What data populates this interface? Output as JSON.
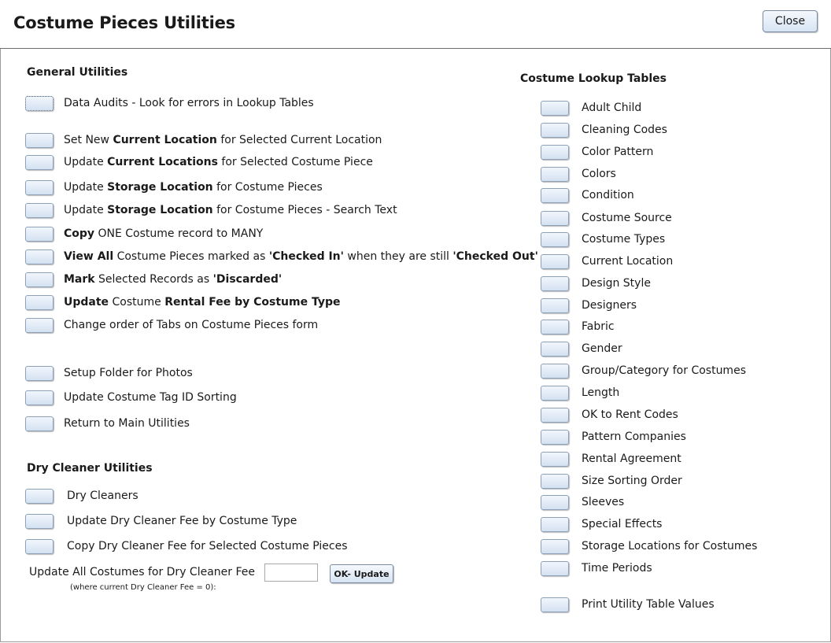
{
  "window": {
    "title": "Costume Pieces Utilities",
    "close_label": "Close"
  },
  "general": {
    "title": "General Utilities",
    "data_audits": "Data Audits - Look for errors in Lookup Tables",
    "set_new_loc": {
      "a": "Set New ",
      "b": "Current Location",
      "c": " for Selected Current Location"
    },
    "update_cur_loc": {
      "a": "Update ",
      "b": "Current Locations",
      "c": " for Selected Costume Piece"
    },
    "update_storage": {
      "a": "Update ",
      "b": "Storage Location",
      "c": " for Costume Pieces"
    },
    "update_storage_search": {
      "a": "Update ",
      "b": "Storage Location",
      "c": " for Costume Pieces - Search Text"
    },
    "copy_one": {
      "a": "Copy",
      "b": " ONE Costume record to MANY"
    },
    "view_all": {
      "a": "View All",
      "b": " Costume Pieces marked as ",
      "c": "'Checked In'",
      "d": " when they are still ",
      "e": "'Checked Out'"
    },
    "mark_discarded": {
      "a": "Mark",
      "b": " Selected Records as ",
      "c": "'Discarded'"
    },
    "update_rental": {
      "a": "Update",
      "b": " Costume ",
      "c": "Rental Fee by Costume Type"
    },
    "change_tabs": "Change order of Tabs on Costume Pieces form",
    "setup_photos": "Setup Folder for Photos",
    "update_tag_sort": "Update Costume Tag ID Sorting",
    "return_main": "Return to Main Utilities"
  },
  "dry": {
    "title": "Dry Cleaner Utilities",
    "dry_cleaners": "Dry Cleaners",
    "update_fee_type": "Update Dry Cleaner Fee by Costume Type",
    "copy_fee": "Copy Dry Cleaner Fee for Selected Costume Pieces",
    "update_all_label": "Update All Costumes for Dry Cleaner Fee",
    "update_all_note": "(where current Dry Cleaner Fee = 0):",
    "fee_value": "",
    "ok_label": "OK- Update"
  },
  "lookup": {
    "title": "Costume  Lookup Tables",
    "items": [
      "Adult Child",
      "Cleaning Codes",
      "Color Pattern",
      "Colors",
      "Condition",
      "Costume Source",
      "Costume Types",
      "Current Location",
      "Design Style",
      "Designers",
      "Fabric",
      "Gender",
      "Group/Category for Costumes",
      "Length",
      "OK to Rent Codes",
      "Pattern Companies",
      "Rental Agreement",
      "Size Sorting Order",
      "Sleeves",
      "Special Effects",
      "Storage Locations for Costumes",
      "Time Periods"
    ],
    "print": "Print Utility Table Values"
  }
}
